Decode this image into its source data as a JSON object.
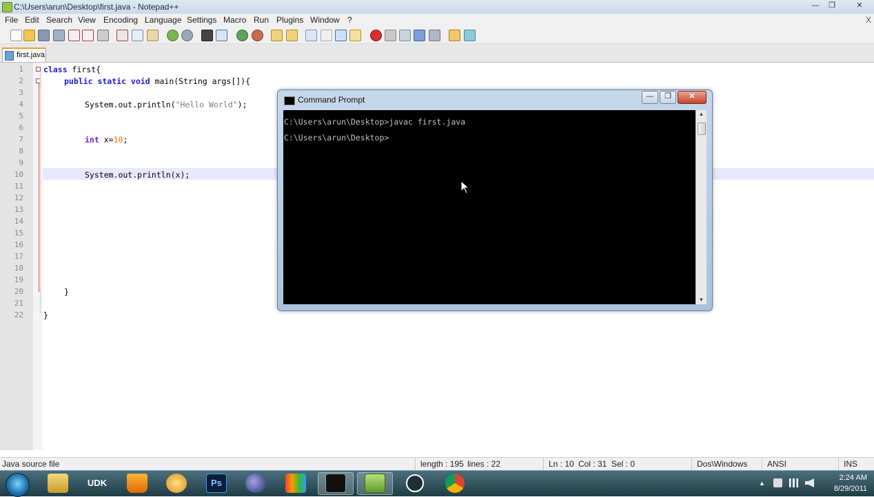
{
  "window": {
    "title": "C:\\Users\\arun\\Desktop\\first.java - Notepad++",
    "minimize_glyph": "—",
    "maximize_glyph": "❐",
    "close_glyph": "✕"
  },
  "menu": {
    "items": [
      "File",
      "Edit",
      "Search",
      "View",
      "Encoding",
      "Language",
      "Settings",
      "Macro",
      "Run",
      "Plugins",
      "Window",
      "?"
    ],
    "close_glyph": "X"
  },
  "toolbar": {
    "icons": [
      "new-file-icon",
      "open-file-icon",
      "save-icon",
      "save-all-icon",
      "close-icon",
      "close-all-icon",
      "print-icon",
      "cut-icon",
      "copy-icon",
      "paste-icon",
      "undo-icon",
      "redo-icon",
      "find-icon",
      "replace-icon",
      "zoom-in-icon",
      "zoom-out-icon",
      "sync-v-icon",
      "sync-h-icon",
      "word-wrap-icon",
      "show-all-chars-icon",
      "indent-guide-icon",
      "user-lang-icon",
      "record-macro-icon",
      "stop-record-icon",
      "play-macro-icon",
      "run-macro-multiple-icon",
      "save-macro-icon",
      "launch-browser-icon",
      "spellcheck-icon"
    ]
  },
  "tab": {
    "label": "first.java",
    "icon": "java-file-icon"
  },
  "editor": {
    "line_numbers": [
      "1",
      "2",
      "3",
      "4",
      "5",
      "6",
      "7",
      "8",
      "9",
      "10",
      "11",
      "12",
      "13",
      "14",
      "15",
      "16",
      "17",
      "18",
      "19",
      "20",
      "21",
      "22"
    ],
    "current_line": 10,
    "code": {
      "l1_kw": "class",
      "l1_rest": " first{",
      "l2_kw": "public static void",
      "l2_rest": " main(String args[]){",
      "l4_a": "System.out.println(",
      "l4_str": "\"Hello World\"",
      "l4_b": ");",
      "l7_kw": "int",
      "l7_a": " x=",
      "l7_num": "10",
      "l7_b": ";",
      "l10": "System.out.println(x);",
      "l20": "}",
      "l22": "}"
    }
  },
  "status": {
    "file_type": "Java source file",
    "length": "length : 195",
    "lines": "lines : 22",
    "ln": "Ln : 10",
    "col": "Col : 31",
    "sel": "Sel : 0",
    "eol": "Dos\\Windows",
    "encoding": "ANSI",
    "mode": "INS"
  },
  "cmd": {
    "title": "Command Prompt",
    "minimize_glyph": "—",
    "maximize_glyph": "❐",
    "close_glyph": "✕",
    "lines": [
      "C:\\Users\\arun\\Desktop>javac first.java",
      "C:\\Users\\arun\\Desktop>"
    ]
  },
  "taskbar": {
    "apps": [
      "windows-explorer-icon",
      "udk-icon",
      "vlc-icon",
      "media-center-icon",
      "photoshop-icon",
      "eclipse-icon",
      "colorful-app-icon",
      "command-prompt-icon",
      "notepad-plus-plus-icon",
      "hp-icon",
      "chrome-icon"
    ],
    "udk_label": "UDK",
    "ps_label": "Ps",
    "time": "2:24 AM",
    "date": "8/29/2011"
  },
  "colors": {
    "keyword": "#1b1bd6",
    "type": "#7a22c2",
    "string": "#808080",
    "number": "#ff6a00",
    "current_line": "#e8e8ff"
  }
}
